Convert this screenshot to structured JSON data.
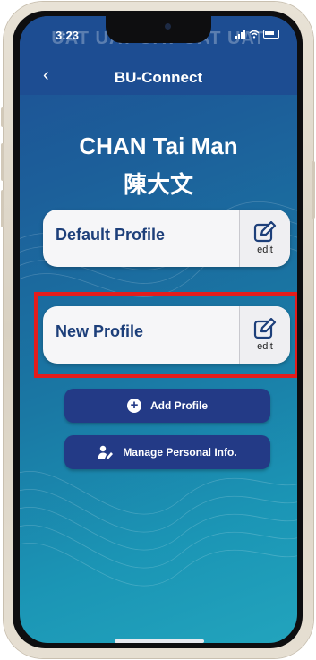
{
  "status_bar": {
    "time": "3:23",
    "watermark": "UAT UAT UAT UAT UAT"
  },
  "header": {
    "back_icon": "chevron-left-icon",
    "title": "BU-Connect"
  },
  "user": {
    "name_en": "CHAN Tai Man",
    "name_zh": "陳大文"
  },
  "profiles": [
    {
      "name": "Default Profile",
      "edit_label": "edit",
      "edit_icon": "edit-icon"
    },
    {
      "name": "New Profile",
      "edit_label": "edit",
      "edit_icon": "edit-icon",
      "highlighted": true
    }
  ],
  "actions": {
    "add_profile": {
      "label": "Add Profile",
      "icon": "plus-circle-icon"
    },
    "manage_info": {
      "label": "Manage Personal Info.",
      "icon": "user-edit-icon"
    }
  },
  "colors": {
    "header": "#1d4d92",
    "button": "#233a86",
    "card_text": "#1d3f7a",
    "highlight": "#e41d1d"
  }
}
